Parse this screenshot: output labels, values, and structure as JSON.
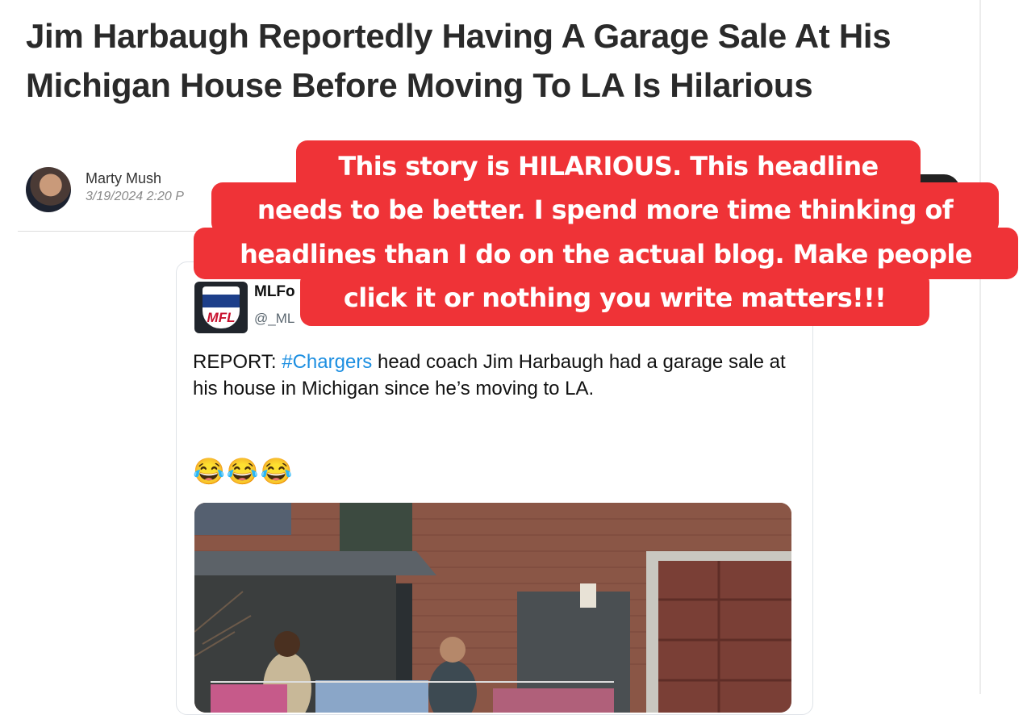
{
  "article": {
    "title": "Jim Harbaugh Reportedly Having A Garage Sale At His Michigan House Before Moving To LA Is Hilarious",
    "author": "Marty Mush",
    "date": "3/19/2024 2:20 P"
  },
  "tweet": {
    "name": "MLFo",
    "handle": "@_ML",
    "avatar_logo_text": "MFL",
    "text_before": "REPORT: ",
    "hashtag": "#Chargers",
    "text_after": " head coach Jim Harbaugh had a garage sale at his house in Michigan since he’s moving to LA.",
    "emojis": "😂😂😂"
  },
  "annotation": {
    "lines": [
      "This story is HILARIOUS. This headline",
      "needs to be better. I spend more time thinking of",
      "headlines than I do on the actual blog. Make people",
      "click it or nothing you write matters!!!"
    ],
    "color": "#ef3337"
  }
}
